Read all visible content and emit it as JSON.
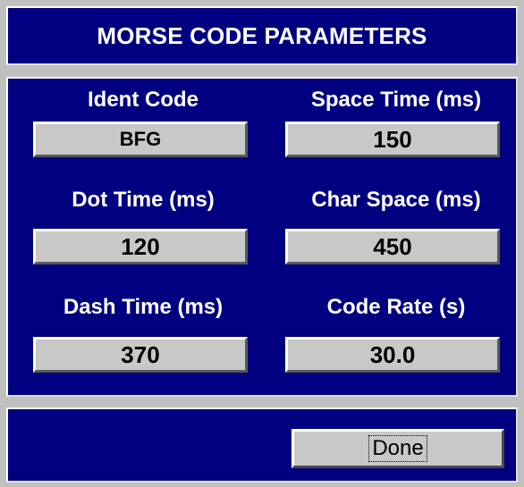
{
  "title": "MORSE CODE PARAMETERS",
  "fields": {
    "ident_code": {
      "label": "Ident Code",
      "value": "BFG"
    },
    "space_time": {
      "label": "Space Time (ms)",
      "value": "150"
    },
    "dot_time": {
      "label": "Dot Time (ms)",
      "value": "120"
    },
    "char_space": {
      "label": "Char Space (ms)",
      "value": "450"
    },
    "dash_time": {
      "label": "Dash Time (ms)",
      "value": "370"
    },
    "code_rate": {
      "label": "Code Rate (s)",
      "value": "30.0"
    }
  },
  "done_label": "Done",
  "colors": {
    "panel_bg": "#000080",
    "window_bg": "#c0c0c0",
    "field_bg": "#c8c8c8",
    "label_text": "#ffffff"
  }
}
